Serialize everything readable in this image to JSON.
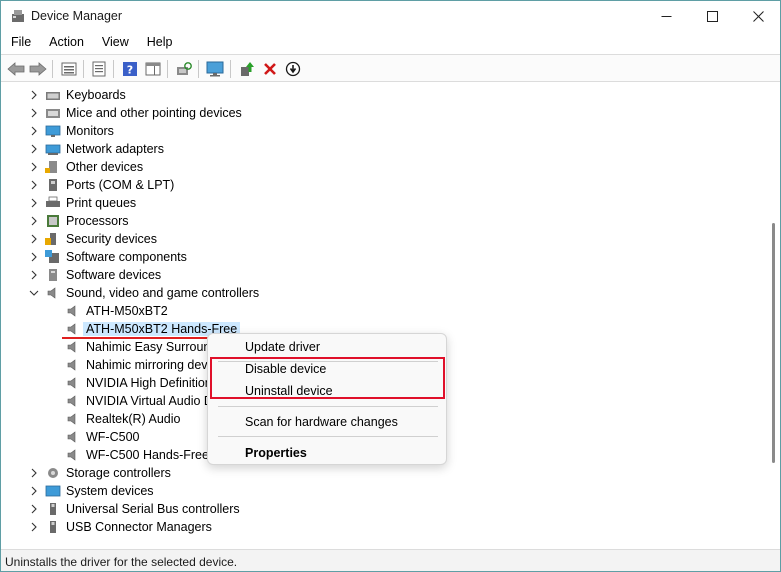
{
  "window": {
    "title": "Device Manager",
    "controls": {
      "minimize": "minimize-icon",
      "maximize": "maximize-icon",
      "close": "close-icon"
    }
  },
  "menu": [
    "File",
    "Action",
    "View",
    "Help"
  ],
  "toolbar": {
    "icons": [
      "back-arrow-icon",
      "forward-arrow-icon",
      "tree-view-icon",
      "properties-icon",
      "help-icon",
      "action-pane-icon",
      "scan-hardware-icon",
      "monitor-icon",
      "update-driver-icon",
      "uninstall-icon",
      "disable-icon"
    ]
  },
  "tree": {
    "items": [
      {
        "label": "Keyboards",
        "level": 0,
        "expanded": false,
        "icon": "keyboard-icon"
      },
      {
        "label": "Mice and other pointing devices",
        "level": 0,
        "expanded": false,
        "icon": "mouse-icon"
      },
      {
        "label": "Monitors",
        "level": 0,
        "expanded": false,
        "icon": "monitor-icon"
      },
      {
        "label": "Network adapters",
        "level": 0,
        "expanded": false,
        "icon": "network-adapter-icon"
      },
      {
        "label": "Other devices",
        "level": 0,
        "expanded": false,
        "icon": "other-device-icon"
      },
      {
        "label": "Ports (COM & LPT)",
        "level": 0,
        "expanded": false,
        "icon": "port-icon"
      },
      {
        "label": "Print queues",
        "level": 0,
        "expanded": false,
        "icon": "printer-icon"
      },
      {
        "label": "Processors",
        "level": 0,
        "expanded": false,
        "icon": "processor-icon"
      },
      {
        "label": "Security devices",
        "level": 0,
        "expanded": false,
        "icon": "security-device-icon"
      },
      {
        "label": "Software components",
        "level": 0,
        "expanded": false,
        "icon": "software-component-icon"
      },
      {
        "label": "Software devices",
        "level": 0,
        "expanded": false,
        "icon": "software-device-icon"
      },
      {
        "label": "Sound, video and game controllers",
        "level": 0,
        "expanded": true,
        "icon": "speaker-icon"
      },
      {
        "label": "ATH-M50xBT2",
        "level": 1,
        "icon": "speaker-icon"
      },
      {
        "label": "ATH-M50xBT2 Hands-Free",
        "level": 1,
        "icon": "speaker-icon",
        "selected": true
      },
      {
        "label": "Nahimic Easy Surround",
        "level": 1,
        "icon": "speaker-icon"
      },
      {
        "label": "Nahimic mirroring devi",
        "level": 1,
        "icon": "speaker-icon"
      },
      {
        "label": "NVIDIA High Definition",
        "level": 1,
        "icon": "speaker-icon"
      },
      {
        "label": "NVIDIA Virtual Audio De",
        "level": 1,
        "icon": "speaker-icon"
      },
      {
        "label": "Realtek(R) Audio",
        "level": 1,
        "icon": "speaker-icon"
      },
      {
        "label": "WF-C500",
        "level": 1,
        "icon": "speaker-icon"
      },
      {
        "label": "WF-C500 Hands-Free",
        "level": 1,
        "icon": "speaker-icon"
      },
      {
        "label": "Storage controllers",
        "level": 0,
        "expanded": false,
        "icon": "storage-controller-icon"
      },
      {
        "label": "System devices",
        "level": 0,
        "expanded": false,
        "icon": "system-device-icon"
      },
      {
        "label": "Universal Serial Bus controllers",
        "level": 0,
        "expanded": false,
        "icon": "usb-icon"
      },
      {
        "label": "USB Connector Managers",
        "level": 0,
        "expanded": false,
        "icon": "usb-icon"
      }
    ]
  },
  "context_menu": {
    "items": [
      "Update driver",
      "Disable device",
      "Uninstall device",
      "Scan for hardware changes",
      "Properties"
    ]
  },
  "status_bar": {
    "text": "Uninstalls the driver for the selected device."
  },
  "colors": {
    "highlight": "#e0102a",
    "selection": "#cce8ff",
    "accent": "#5f9ea5"
  }
}
